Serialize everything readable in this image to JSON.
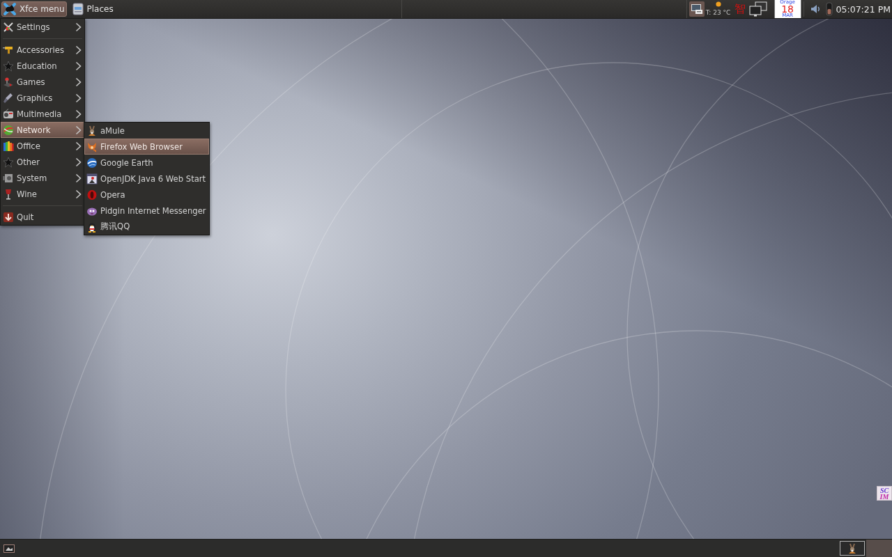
{
  "top_panel": {
    "buttons": [
      {
        "label": "Xfce menu",
        "pressed": true
      },
      {
        "label": "Places",
        "pressed": false
      }
    ],
    "weather": {
      "temperature": "T: 23 °C"
    },
    "input_method": "智",
    "calendar": {
      "title": "Orage",
      "day": "18",
      "month": "MAR"
    },
    "clock": "05:07:21 PM"
  },
  "main_menu": {
    "items": [
      {
        "kind": "item",
        "label": "Settings",
        "has_submenu": true,
        "selected": false
      },
      {
        "kind": "separator"
      },
      {
        "kind": "item",
        "label": "Accessories",
        "has_submenu": true,
        "selected": false
      },
      {
        "kind": "item",
        "label": "Education",
        "has_submenu": true,
        "selected": false
      },
      {
        "kind": "item",
        "label": "Games",
        "has_submenu": true,
        "selected": false
      },
      {
        "kind": "item",
        "label": "Graphics",
        "has_submenu": true,
        "selected": false
      },
      {
        "kind": "item",
        "label": "Multimedia",
        "has_submenu": true,
        "selected": false
      },
      {
        "kind": "item",
        "label": "Network",
        "has_submenu": true,
        "selected": true
      },
      {
        "kind": "item",
        "label": "Office",
        "has_submenu": true,
        "selected": false
      },
      {
        "kind": "item",
        "label": "Other",
        "has_submenu": true,
        "selected": false
      },
      {
        "kind": "item",
        "label": "System",
        "has_submenu": true,
        "selected": false
      },
      {
        "kind": "item",
        "label": "Wine",
        "has_submenu": true,
        "selected": false
      },
      {
        "kind": "separator"
      },
      {
        "kind": "item",
        "label": "Quit",
        "has_submenu": false,
        "selected": false
      }
    ]
  },
  "submenu": {
    "items": [
      {
        "label": "aMule",
        "selected": false
      },
      {
        "label": "Firefox Web Browser",
        "selected": true
      },
      {
        "label": "Google Earth",
        "selected": false
      },
      {
        "label": "OpenJDK Java 6 Web Start",
        "selected": false
      },
      {
        "label": "Opera",
        "selected": false
      },
      {
        "label": "Pidgin Internet Messenger",
        "selected": false
      },
      {
        "label": "腾讯QQ",
        "selected": false
      }
    ]
  },
  "desktop": {
    "scim_logo": {
      "lines": [
        "SC",
        "IM"
      ]
    }
  }
}
